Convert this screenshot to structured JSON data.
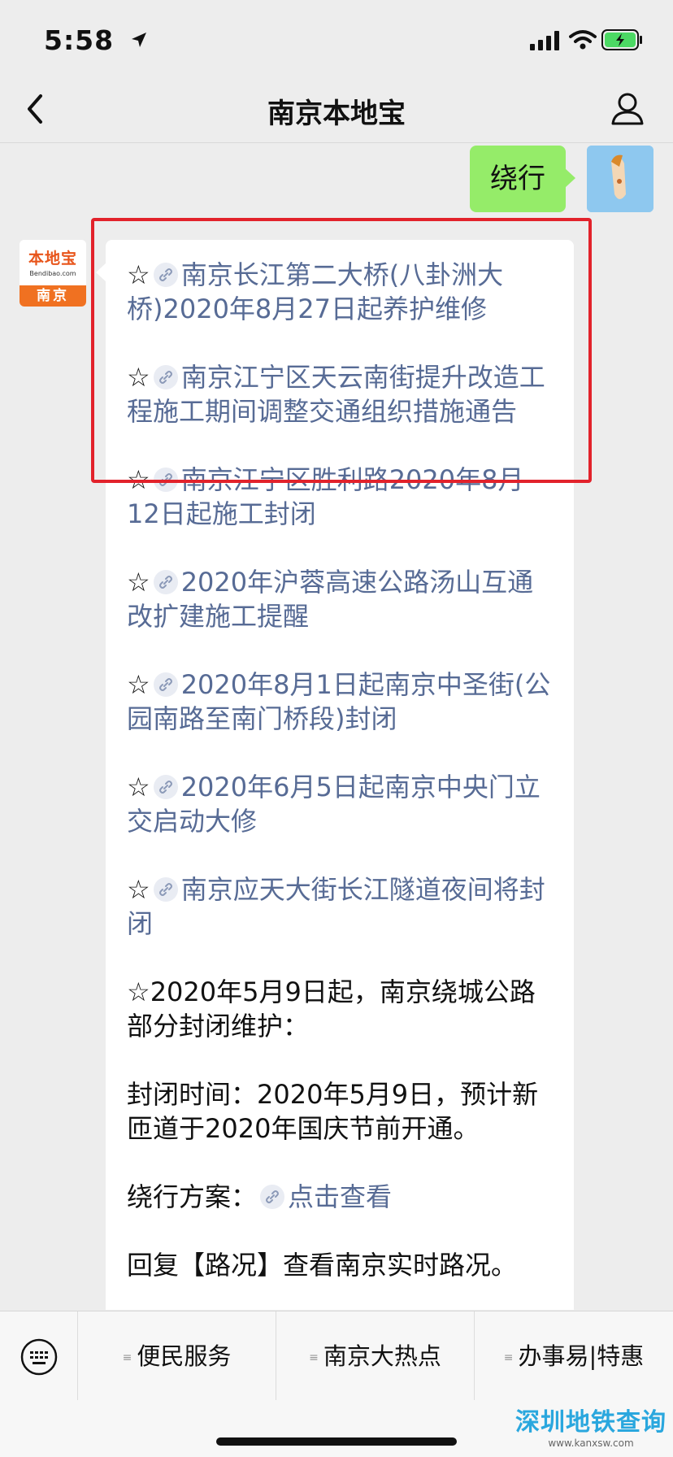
{
  "status_bar": {
    "time": "5:58"
  },
  "nav": {
    "title": "南京本地宝"
  },
  "my_message": {
    "text": "绕行"
  },
  "bot": {
    "logo_brand": "本地宝",
    "logo_url": "Bendibao.com",
    "logo_city": "南京"
  },
  "messages": [
    {
      "star": "☆",
      "type": "link",
      "text": "南京长江第二大桥(八卦洲大桥)2020年8月27日起养护维修"
    },
    {
      "star": "☆",
      "type": "link",
      "text": "南京江宁区天云南街提升改造工程施工期间调整交通组织措施通告"
    },
    {
      "star": "☆",
      "type": "link",
      "text": "南京江宁区胜利路2020年8月12日起施工封闭"
    },
    {
      "star": "☆",
      "type": "link",
      "text": "2020年沪蓉高速公路汤山互通改扩建施工提醒"
    },
    {
      "star": "☆",
      "type": "link",
      "text": "2020年8月1日起南京中圣街(公园南路至南门桥段)封闭"
    },
    {
      "star": "☆",
      "type": "link",
      "text": "2020年6月5日起南京中央门立交启动大修"
    },
    {
      "star": "☆",
      "type": "link",
      "text": "南京应天大街长江隧道夜间将封闭"
    }
  ],
  "notice": {
    "line1": "☆2020年5月9日起，南京绕城公路部分封闭维护：",
    "line2": "封闭时间：2020年5月9日，预计新匝道于2020年国庆节前开通。",
    "route_label": "绕行方案：",
    "route_link": "点击查看",
    "reply": "回复【路况】查看南京实时路况。"
  },
  "menu": {
    "tab1": "便民服务",
    "tab2": "南京大热点",
    "tab3": "办事易|特惠",
    "glyph": "≡"
  },
  "watermark": {
    "text": "深圳地铁查询",
    "url": "www.kanxsw.com"
  },
  "colors": {
    "link": "#576b95",
    "my_bubble": "#95ec69",
    "highlight": "#e2222b"
  }
}
